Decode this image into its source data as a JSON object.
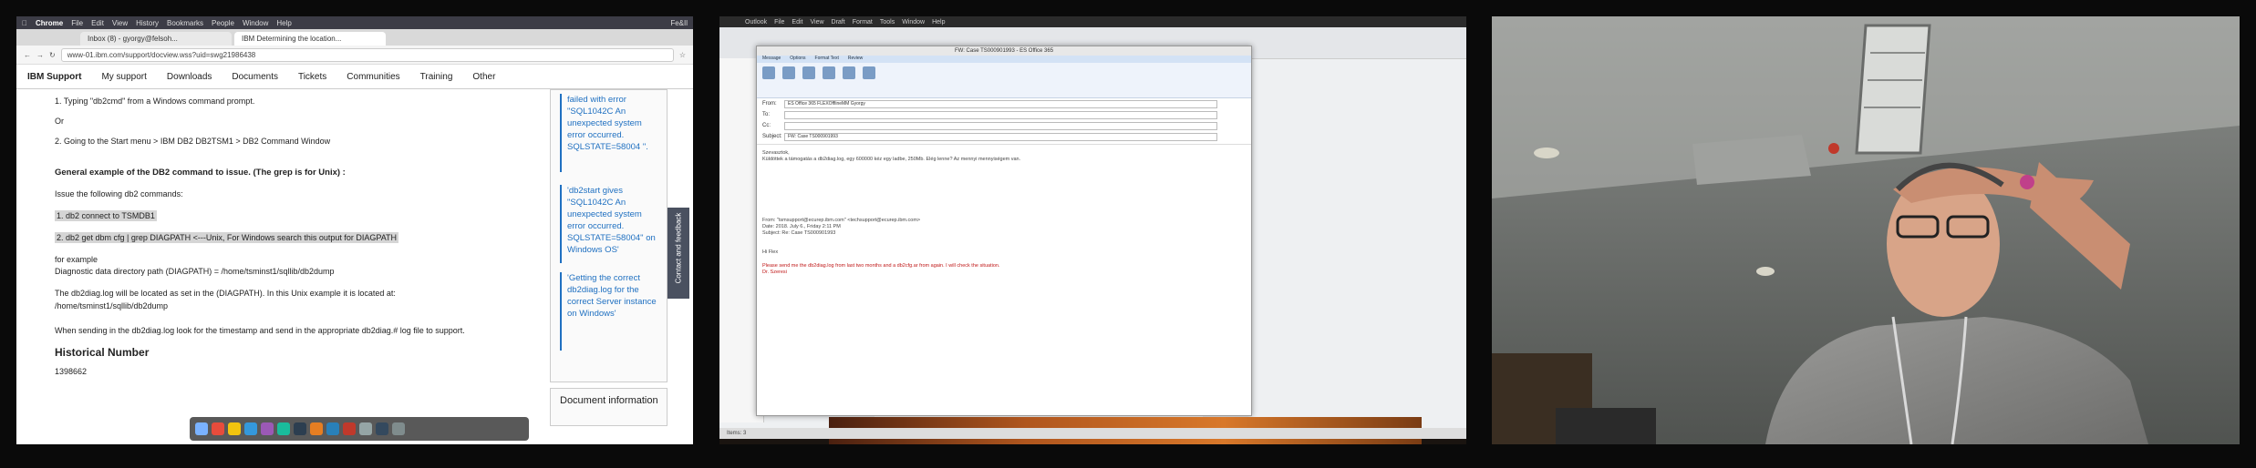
{
  "panel1": {
    "menubar": {
      "apple": "",
      "app": "Chrome",
      "items": [
        "File",
        "Edit",
        "View",
        "History",
        "Bookmarks",
        "People",
        "Window",
        "Help"
      ],
      "right": "Fe&Il"
    },
    "tabs": [
      {
        "label": "Inbox (8) - gyorgy@felsoh..."
      },
      {
        "label": "IBM Determining the location..."
      }
    ],
    "address": "www-01.ibm.com/support/docview.wss?uid=swg21986438",
    "nav": {
      "brand": "IBM Support",
      "items": [
        "My support",
        "Downloads",
        "Documents",
        "Tickets",
        "Communities",
        "Training",
        "Other"
      ]
    },
    "content": {
      "l1": "1. Typing \"db2cmd\" from a Windows command prompt.",
      "l2": "Or",
      "l3": "2. Going to the Start menu > IBM DB2 DB2TSM1 > DB2 Command Window",
      "h1": "General example of the DB2 command to issue. (The grep is for Unix) :",
      "l4": "Issue the following db2 commands:",
      "c1": "1. db2 connect to TSMDB1",
      "c2": "2. db2 get dbm cfg | grep DIAGPATH <---Unix, For Windows search this output for DIAGPATH",
      "l5": "for example",
      "l6": "Diagnostic data directory path (DIAGPATH) = /home/tsminst1/sqllib/db2dump",
      "l7": "The db2diag.log will be located as set in the (DIAGPATH). In this Unix example it is located at:",
      "l8": "/home/tsminst1/sqllib/db2dump",
      "l9": "When sending in the db2diag.log look for the timestamp and send in the appropriate db2diag.# log file to support.",
      "h2": "Historical Number",
      "num": "1398662"
    },
    "sidebar": {
      "link1": "failed with error \"SQL1042C An unexpected system error occurred. SQLSTATE=58004 \".",
      "link2": "'db2start gives \"SQL1042C An unexpected system error occurred. SQLSTATE=58004\" on Windows OS'",
      "link3": "'Getting the correct db2diag.log for the correct Server instance on Windows'",
      "doc": "Document information"
    },
    "feedback": "Contact and feedback"
  },
  "panel2": {
    "menubar": {
      "app": "Outlook",
      "items": [
        "File",
        "Edit",
        "View",
        "Draft",
        "Format",
        "Tools",
        "Window",
        "Help"
      ]
    },
    "compose": {
      "title": "FW: Case TS000901993 - ES Office 365",
      "tabs": [
        "Message",
        "Options",
        "Format Text",
        "Review"
      ],
      "from": "From:",
      "to": "To:",
      "cc": "Cc:",
      "subject": "Subject:",
      "from_val": "ES Office 365 FLEXOfflineMM Gyorgy",
      "subject_val": "FW: Case TS000901993",
      "greeting": "Szevasztok,",
      "body1": "Küldöttek a támogatás a db2diag.log, egy 600000 kéz egy ladbe, 250Mb. Elég lenne? Az mennyi mennyiségem van.",
      "orig_from": "From: \"tsmsupport@ecurep.ibm.com\" <techsupport@ecurep.ibm.com>",
      "orig_date": "Date: 2018. July 6., Friday 2:11 PM",
      "orig_subject": "Subject: Re: Case TS000901993",
      "hi": "Hi Flex",
      "red": "Please send me the db2diag.log from last two months and a db2cfg.ar from again. I will check the situation.",
      "sig": "Dr. Szeresi"
    },
    "status": "Items: 3"
  },
  "colors": {
    "ibm_link": "#1f70c1",
    "chrome_menubar": "#3c3c46",
    "feedback": "#4a5160",
    "outlook_ribbon": "#eef3fb"
  }
}
